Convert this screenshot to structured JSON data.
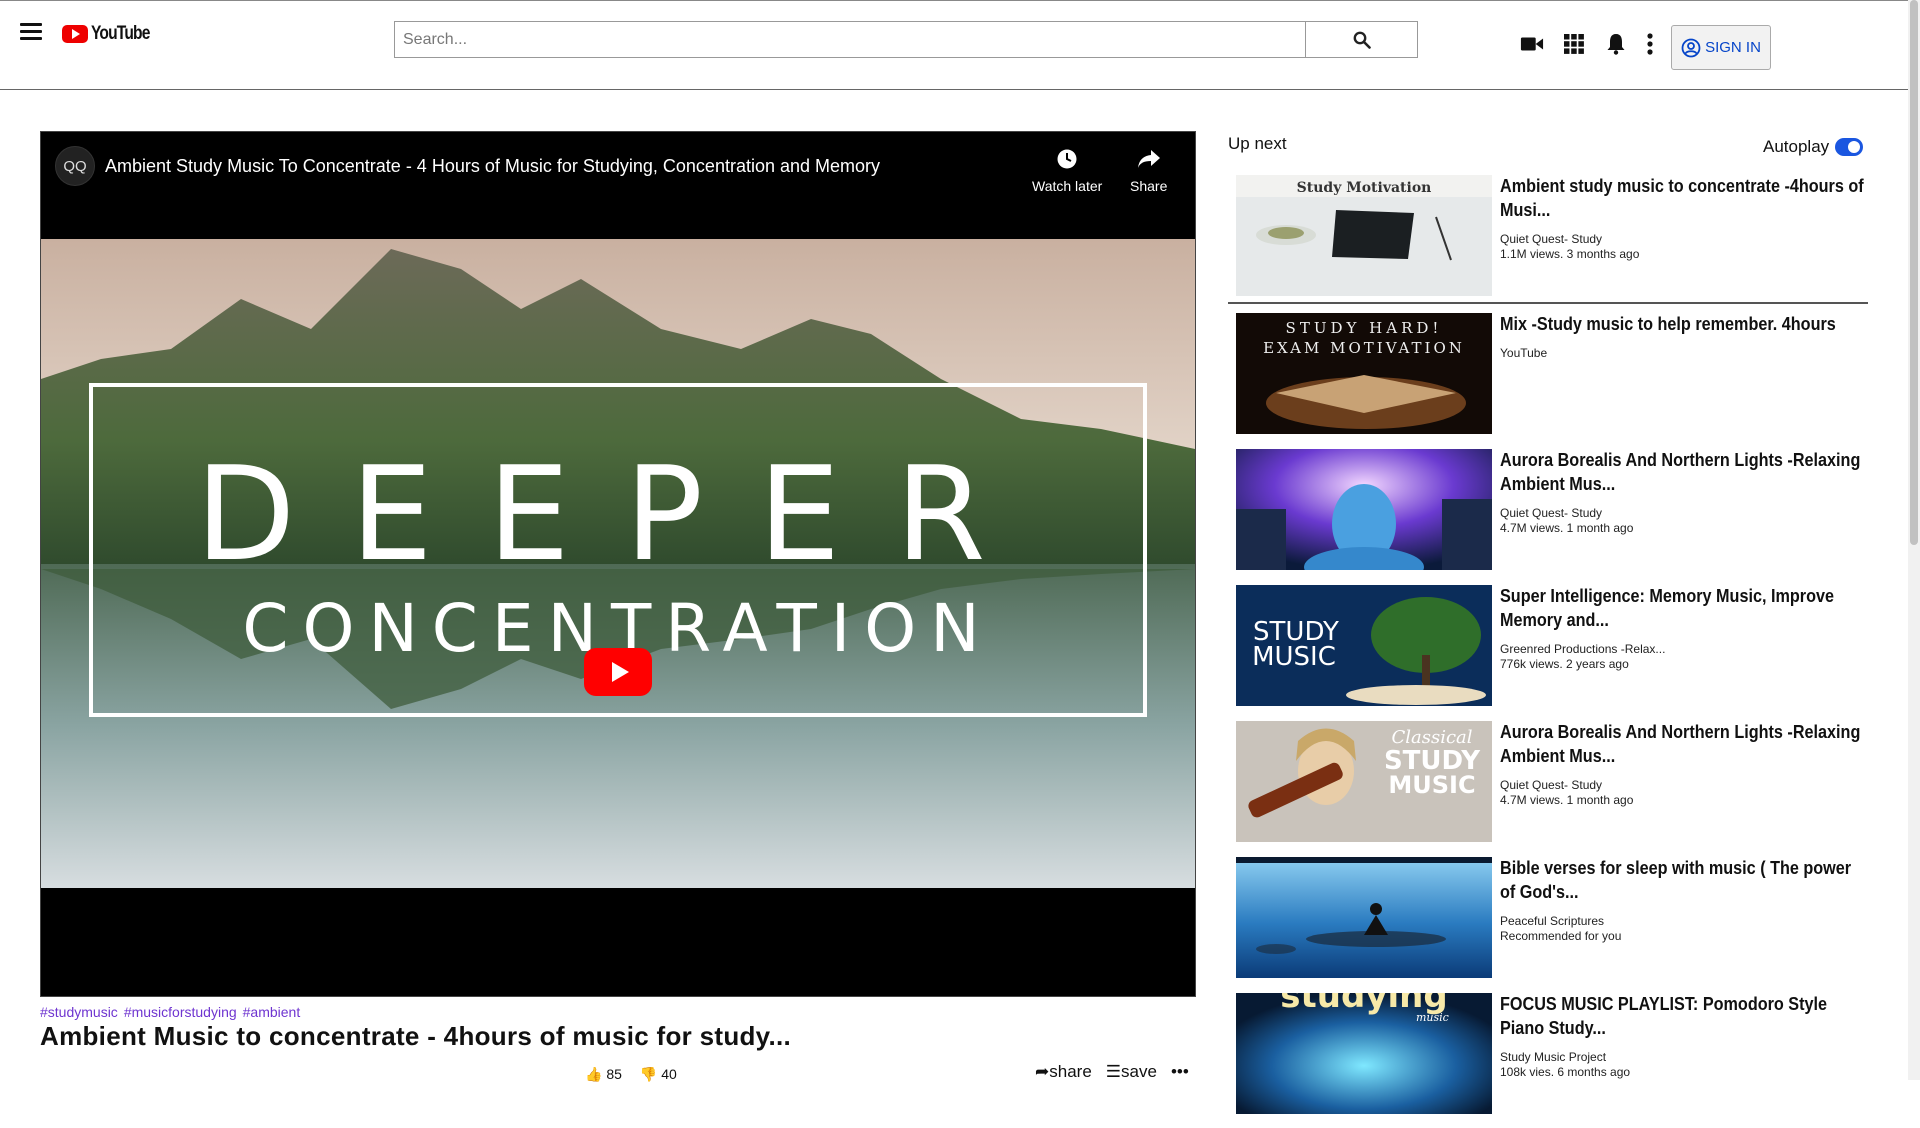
{
  "header": {
    "logo_text": "YouTube",
    "search_placeholder": "Search...",
    "signin_label": "SIGN IN",
    "icons": [
      "menu-icon",
      "search-icon",
      "video-camera-icon",
      "apps-grid-icon",
      "bell-icon",
      "more-vert-icon",
      "account-circle-icon"
    ]
  },
  "player": {
    "channel_avatar": "QQ",
    "title": "Ambient Study Music To Concentrate - 4 Hours of Music for Studying, Concentration and Memory",
    "watch_later_label": "Watch later",
    "share_label": "Share",
    "thumbnail_line1": "DEEPER",
    "thumbnail_line2": "CONCENTRATION"
  },
  "video": {
    "tags": [
      "#studymusic",
      "#musicforstudying",
      "#ambient"
    ],
    "title": "Ambient Music to concentrate - 4hours of music for study...",
    "likes": "85",
    "dislikes": "40",
    "share_label": "share",
    "save_label": "save",
    "more_label": "•••"
  },
  "sidebar": {
    "upnext_label": "Up next",
    "autoplay_label": "Autoplay",
    "autoplay_on": true,
    "items": [
      {
        "title": "Ambient study music to concentrate -4hours of Musi...",
        "channel": "Quiet Quest- Study",
        "views": "1.1M views. 3 months ago",
        "thumb_text": "Study Motivation"
      },
      {
        "title": "Mix -Study music to help remember. 4hours",
        "channel": "YouTube",
        "views": "",
        "thumb_text_1": "STUDY HARD!",
        "thumb_text_2": "EXAM MOTIVATION"
      },
      {
        "title": "Aurora Borealis And Northern Lights -Relaxing Ambient Mus...",
        "channel": "Quiet Quest- Study",
        "views": "4.7M views. 1 month ago"
      },
      {
        "title": "Super Intelligence: Memory Music, Improve Memory and...",
        "channel": "Greenred Productions -Relax...",
        "views": "776k views. 2 years ago",
        "thumb_text_1": "STUDY",
        "thumb_text_2": "MUSIC"
      },
      {
        "title": "Aurora Borealis And Northern Lights -Relaxing Ambient Mus...",
        "channel": "Quiet Quest- Study",
        "views": "4.7M views. 1 month ago",
        "thumb_text_1": "Classical",
        "thumb_text_2": "STUDY",
        "thumb_text_3": "MUSIC"
      },
      {
        "title": "Bible verses for sleep with music ( The power of God's...",
        "channel": "Peaceful Scriptures",
        "views": "Recommended for you"
      },
      {
        "title": "FOCUS MUSIC PLAYLIST: Pomodoro Style Piano Study...",
        "channel": "Study Music Project",
        "views": "108k vies. 6 months ago",
        "thumb_text_1": "studying",
        "thumb_text_2": "music"
      }
    ]
  },
  "colors": {
    "brand_red": "#ff0000",
    "signin_blue": "#0645c9",
    "tag_purple": "#6f35d0",
    "toggle_blue": "#1a56e0"
  }
}
